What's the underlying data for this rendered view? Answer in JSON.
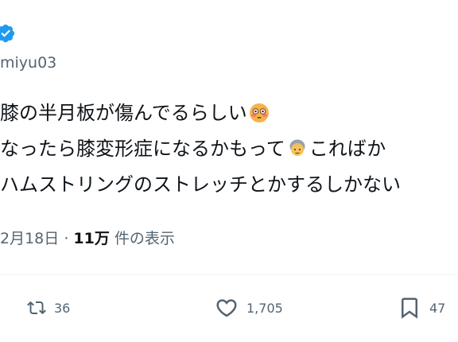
{
  "post": {
    "author_handle": "miyu03",
    "text_line1": "膝の半月板が傷んでるらしい",
    "text_line2": "なったら膝変形症になるかもって",
    "text_line2_tail": "こればか",
    "text_line3": "ハムストリングのストレッチとかするしかない",
    "emoji1": "flushed-face",
    "emoji2": "older-person",
    "date": "2月18日",
    "separator": "·",
    "views_count": "11万",
    "views_label": "件の表示"
  },
  "actions": {
    "retweet_count": "36",
    "like_count": "1,705",
    "bookmark_count": "47"
  },
  "colors": {
    "verified": "#1d9bf0",
    "text": "#0f1419",
    "muted": "#536471",
    "divider": "#eff3f4"
  }
}
